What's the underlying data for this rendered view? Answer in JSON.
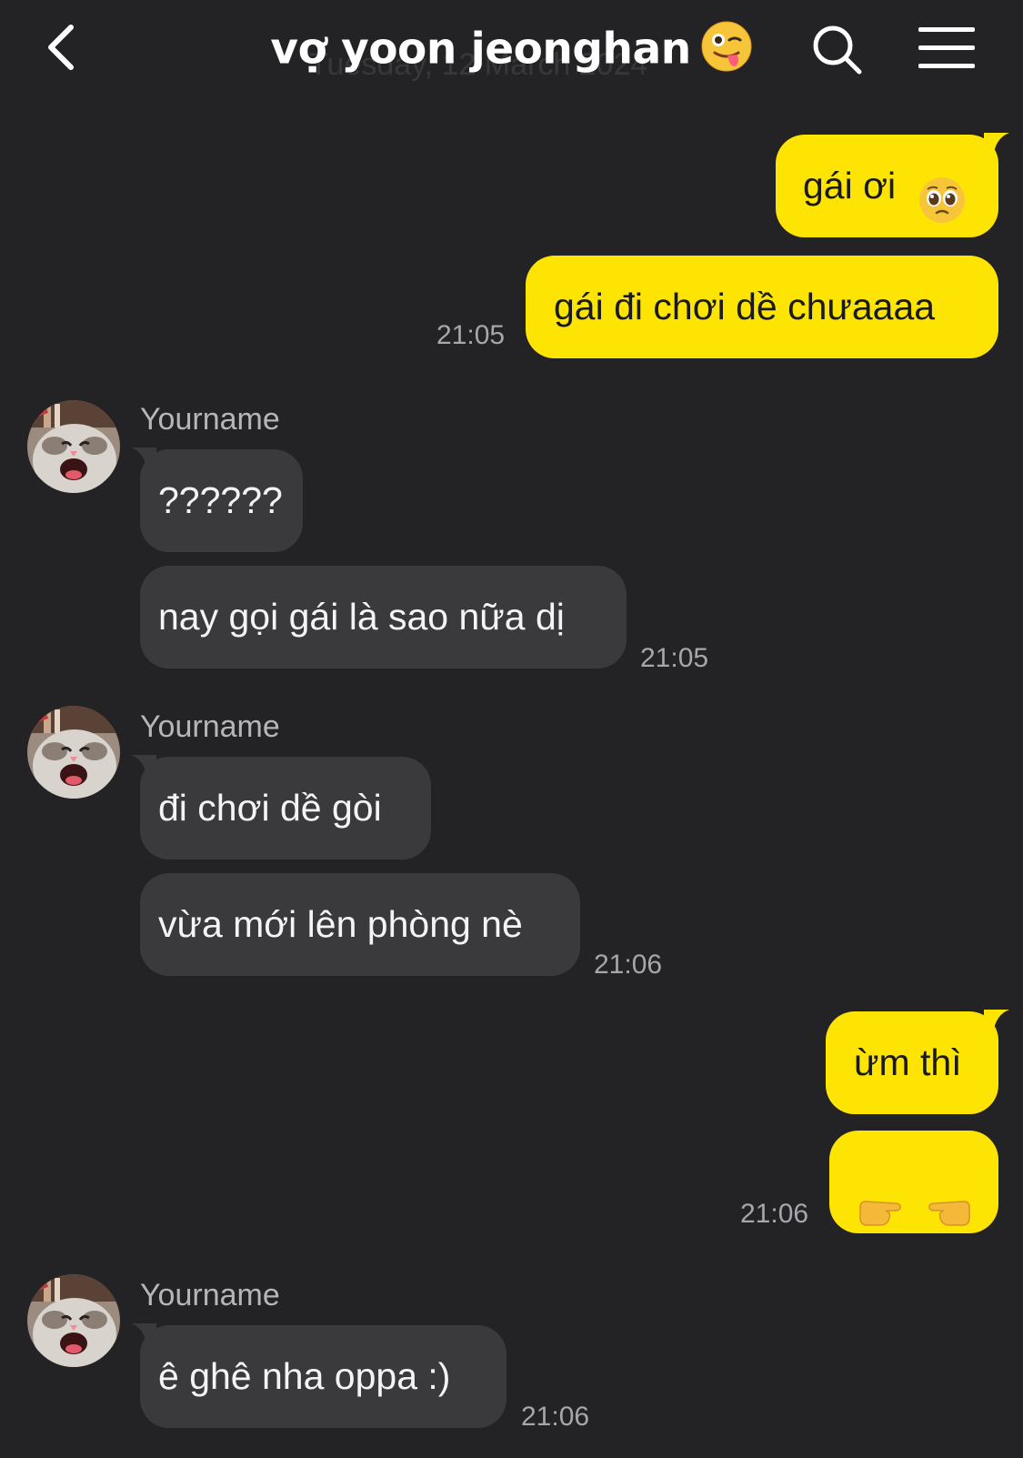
{
  "header": {
    "title": "vợ yoon jeonghan",
    "date_ghost": "Tuesday, 12 March 2024"
  },
  "messages": [
    {
      "from": "me",
      "text": "gái ơi",
      "emoji": "pleading-face-icon"
    },
    {
      "from": "me",
      "text": "gái đi chơi dề chưaaaa",
      "time": "21:05"
    },
    {
      "from": "them",
      "sender": "Yourname",
      "text": "??????"
    },
    {
      "from": "them",
      "text": "nay gọi gái là sao nữa dị",
      "time": "21:05"
    },
    {
      "from": "them",
      "sender": "Yourname",
      "text": "đi chơi dề gòi"
    },
    {
      "from": "them",
      "text": "vừa mới lên phòng nè",
      "time": "21:06"
    },
    {
      "from": "me",
      "text": "ừm thì"
    },
    {
      "from": "me",
      "text": "",
      "emoji": "pointing-fingers-icon",
      "time": "21:06"
    },
    {
      "from": "them",
      "sender": "Yourname",
      "text": "ê ghê nha oppa :)",
      "time": "21:06"
    }
  ],
  "colors": {
    "background": "#232326",
    "my_bubble": "#fde403",
    "their_bubble": "#3a3a3d"
  }
}
